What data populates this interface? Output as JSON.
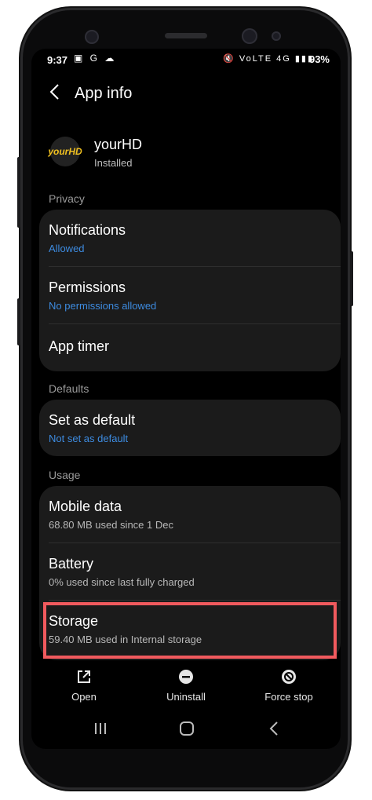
{
  "status": {
    "time": "9:37",
    "left_icons": "▣ G ☁",
    "right_icons": "🔇 VoLTE 4G ▮▮▮",
    "battery": "93%"
  },
  "header": {
    "back_icon": "chevron-left-icon",
    "title": "App info"
  },
  "app": {
    "icon_text": "yourHD",
    "name": "yourHD",
    "status": "Installed"
  },
  "sections": {
    "privacy": "Privacy",
    "defaults": "Defaults",
    "usage": "Usage"
  },
  "privacy_items": [
    {
      "label": "Notifications",
      "sub": "Allowed"
    },
    {
      "label": "Permissions",
      "sub": "No permissions allowed"
    },
    {
      "label": "App timer",
      "sub": ""
    }
  ],
  "defaults_items": [
    {
      "label": "Set as default",
      "sub": "Not set as default"
    }
  ],
  "usage_items": [
    {
      "label": "Mobile data",
      "sub": "68.80 MB used since 1 Dec"
    },
    {
      "label": "Battery",
      "sub": "0% used since last fully charged"
    },
    {
      "label": "Storage",
      "sub": "59.40 MB used in Internal storage"
    }
  ],
  "actions": {
    "open": "Open",
    "uninstall": "Uninstall",
    "force_stop": "Force stop"
  },
  "colors": {
    "accent": "#3d8be0",
    "highlight": "#f15a5e",
    "card": "#1b1b1b"
  }
}
